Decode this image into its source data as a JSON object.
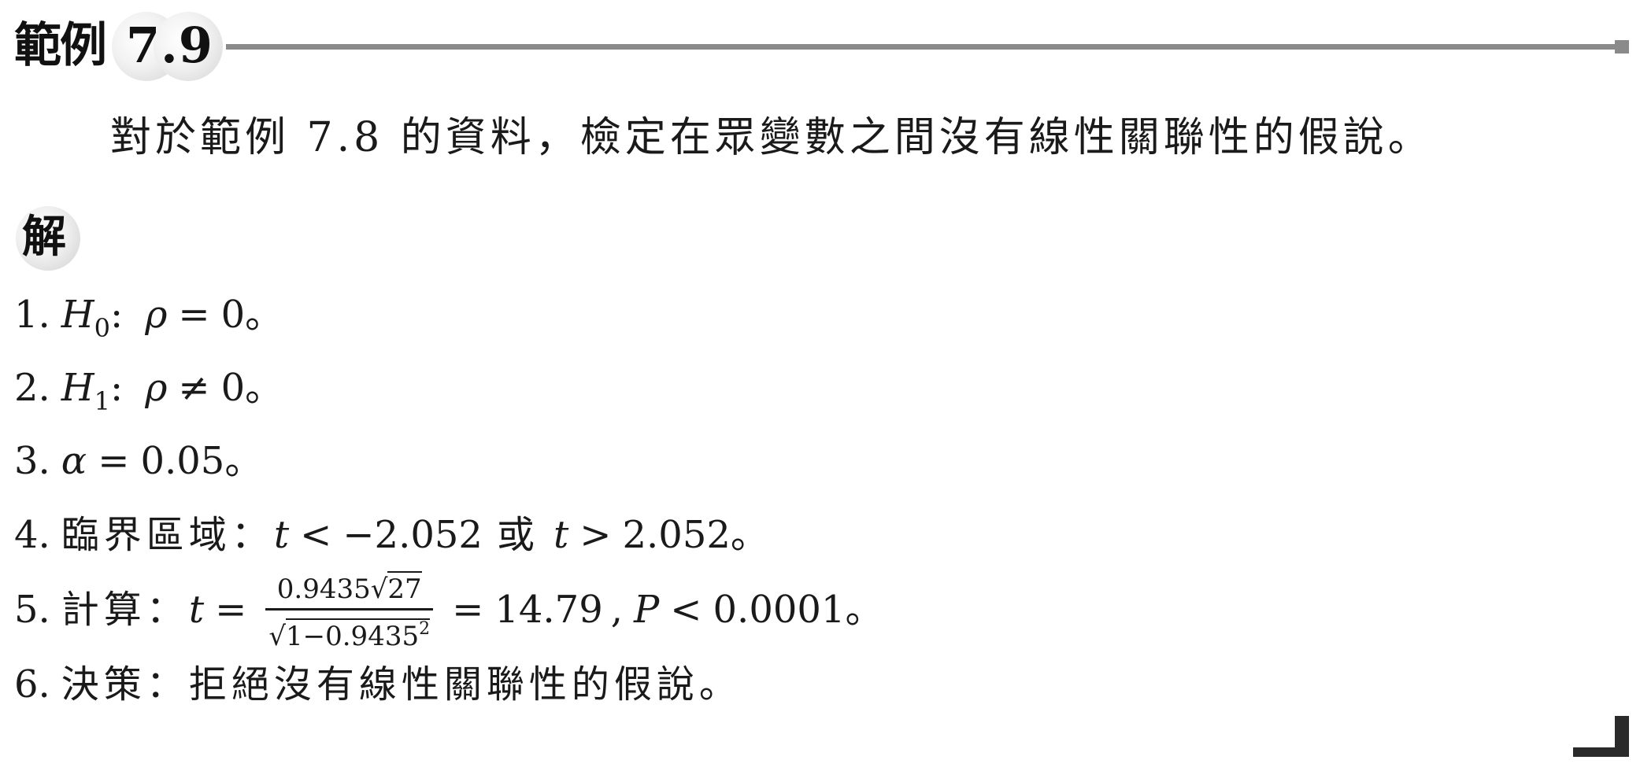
{
  "header": {
    "example_label": "範例",
    "example_number": "7.9"
  },
  "problem": {
    "text": "對於範例 7.8 的資料，檢定在眾變數之間沒有線性關聯性的假說。"
  },
  "solution": {
    "label": "解",
    "steps": [
      {
        "num": "1.",
        "var": "H",
        "sub": "0",
        "colon": ":",
        "rho": "ρ",
        "op": "=",
        "value": "0",
        "end": "。"
      },
      {
        "num": "2.",
        "var": "H",
        "sub": "1",
        "colon": ":",
        "rho": "ρ",
        "op": "≠",
        "value": "0",
        "end": "。"
      },
      {
        "num": "3.",
        "alpha": "α",
        "op": "=",
        "value": "0.05",
        "end": "。"
      },
      {
        "num": "4.",
        "label": "臨界區域：",
        "t1": "t",
        "op1": "<",
        "v1": "−2.052",
        "or": "或",
        "t2": "t",
        "op2": ">",
        "v2": "2.052",
        "end": "。"
      },
      {
        "num": "5.",
        "label": "計算：",
        "t": "t",
        "eq": "=",
        "frac_num_left": "0.9435",
        "frac_num_sqrt_symbol": "√",
        "frac_num_sqrt": "27",
        "frac_den_sqrt_symbol": "√",
        "frac_den_inner": "1−0.9435",
        "frac_den_exp": "2",
        "eq2": "=",
        "result": "14.79",
        "comma": ",",
        "p": "P",
        "op": "<",
        "p_value": "0.0001",
        "end": "。"
      },
      {
        "num": "6.",
        "label": "決策：",
        "text": "拒絕沒有線性關聯性的假說。"
      }
    ]
  }
}
